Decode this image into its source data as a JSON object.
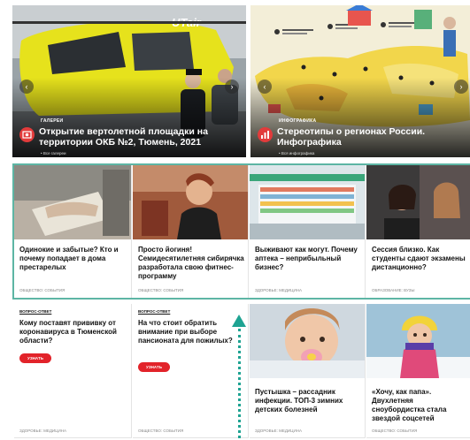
{
  "hero": [
    {
      "rubric": "ГАЛЕРЕИ",
      "title": "Открытие вертолетной площадки на территории ОКБ №2, Тюмень, 2021",
      "all_link": "• Все галереи",
      "brand_text": "UTair",
      "icon": "gallery-icon",
      "prev": "‹",
      "next": "›"
    },
    {
      "rubric": "ИНФОГРАФИКА",
      "title": "Стереотипы о регионах России. Инфографика",
      "all_link": "• Вся инфографика",
      "icon": "infographic-icon",
      "prev": "‹",
      "next": "›"
    }
  ],
  "cards": [
    {
      "title": "Одинокие и забытые? Кто и почему попадает в дома престарелых",
      "tag": "ОБЩЕСТВО: СОБЫТИЯ"
    },
    {
      "title": "Просто йогиня! Семидесятилетняя сибирячка разработала свою фитнес-программу",
      "tag": "ОБЩЕСТВО: СОБЫТИЯ"
    },
    {
      "title": "Выживают как могут. Почему аптека – неприбыльный бизнес?",
      "tag": "ЗДОРОВЬЕ: МЕДИЦИНА"
    },
    {
      "title": "Сессия близко. Как студенты сдают экзамены дистанционно?",
      "tag": "ОБРАЗОВАНИЕ: ВУЗЫ"
    }
  ],
  "questions": [
    {
      "label": "ВОПРОС-ОТВЕТ",
      "title": "Кому поставят прививку от коронавируса в Тюменской области?",
      "button": "УЗНАТЬ",
      "tag": "ЗДОРОВЬЕ: МЕДИЦИНА"
    },
    {
      "label": "ВОПРОС-ОТВЕТ",
      "title": "На что стоит обратить внимание при выборе пансионата для пожилых?",
      "button": "УЗНАТЬ",
      "tag": "ОБЩЕСТВО: СОБЫТИЯ"
    }
  ],
  "photo_cards": [
    {
      "title": "Пустышка – рассадник инфекции. ТОП-3 зимних детских болезней",
      "tag": "ЗДОРОВЬЕ: МЕДИЦИНА"
    },
    {
      "title": "«Хочу, как папа». Двухлетняя сноубордистка стала звездой соцсетей",
      "tag": "ОБЩЕСТВО: СОБЫТИЯ"
    }
  ],
  "colors": {
    "accent_red": "#e2232a",
    "highlight_teal": "#5db5a4",
    "arrow_teal": "#1ea392",
    "helicopter_yellow": "#e6e21c"
  }
}
